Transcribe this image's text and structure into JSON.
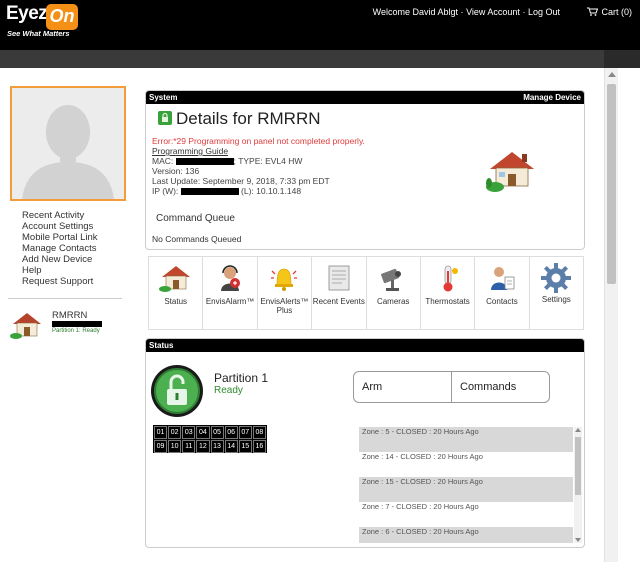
{
  "header": {
    "logo_main": "Eyez",
    "logo_accent": "On",
    "tagline": "See What Matters",
    "welcome": "Welcome David Ablgt",
    "view_account": "View Account",
    "logout": "Log Out",
    "cart": "Cart (0)",
    "separator": "·"
  },
  "sidebar": {
    "links": [
      "Recent Activity",
      "Account Settings",
      "Mobile Portal Link",
      "Manage Contacts",
      "Add New Device",
      "Help",
      "Request Support"
    ],
    "device": {
      "name": "RMRRN",
      "partition": "Partition 1: Ready"
    }
  },
  "system": {
    "header": "System",
    "manage": "Manage Device",
    "title": "Details for RMRRN",
    "error": "Error:*29 Programming on panel not completed properly.",
    "guide": "Programming Guide",
    "mac_label": "MAC:",
    "type": "; TYPE: EVL4 HW",
    "version": "Version: 136",
    "last_update": "Last Update: September 9, 2018, 7:33 pm EDT",
    "ip_label": "IP (W):",
    "ip_local": "(L): 10.10.1.148",
    "cmd_title": "Command Queue",
    "cmd_empty": "No Commands Queued"
  },
  "tiles": [
    {
      "label": "Status",
      "icon": "house-icon"
    },
    {
      "label": "EnvisAlarm™",
      "icon": "alarm-operator-icon"
    },
    {
      "label": "EnvisAlerts™ Plus",
      "icon": "alert-bell-icon"
    },
    {
      "label": "Recent Events",
      "icon": "events-list-icon"
    },
    {
      "label": "Cameras",
      "icon": "camera-icon"
    },
    {
      "label": "Thermostats",
      "icon": "thermostat-icon"
    },
    {
      "label": "Contacts",
      "icon": "contacts-icon"
    },
    {
      "label": "Settings",
      "icon": "gear-icon"
    }
  ],
  "status": {
    "header": "Status",
    "partition": "Partition 1",
    "state": "Ready",
    "arm": "Arm",
    "commands": "Commands",
    "zones": [
      "01",
      "02",
      "03",
      "04",
      "05",
      "06",
      "07",
      "08",
      "09",
      "10",
      "11",
      "12",
      "13",
      "14",
      "15",
      "16"
    ],
    "zone_list": [
      "Zone : 5 - CLOSED : 20 Hours Ago",
      "Zone : 14 - CLOSED : 20 Hours Ago",
      "Zone : 15 - CLOSED : 20 Hours Ago",
      "Zone : 7 - CLOSED : 20 Hours Ago",
      "Zone : 6 - CLOSED : 20 Hours Ago"
    ]
  },
  "colors": {
    "accent": "#f39015",
    "ready": "#2e8b2e",
    "error": "#e03b3b"
  }
}
